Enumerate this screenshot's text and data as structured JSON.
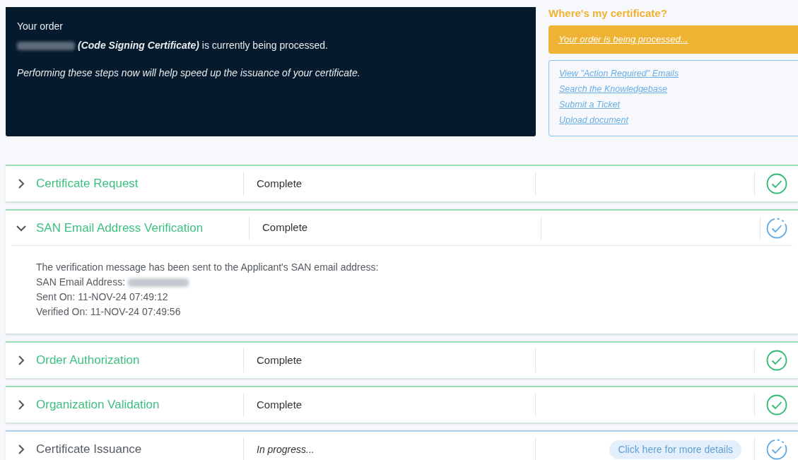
{
  "order_panel": {
    "heading": "Your order",
    "product": "(Code Signing Certificate)",
    "message": "is currently being processed.",
    "note": "Performing these steps now will help speed up the issuance of your certificate."
  },
  "help_panel": {
    "title": "Where's my certificate?",
    "status_link": "Your order is being processed...",
    "links": [
      "View \"Action Required\" Emails",
      "Search the Knowledgebase",
      "Submit a Ticket",
      "Upload document"
    ]
  },
  "steps": [
    {
      "title": "Certificate Request",
      "done": true,
      "expanded": false,
      "status": "Complete",
      "status_italic": false,
      "verified": true
    },
    {
      "title": "SAN Email Address Verification",
      "done": true,
      "expanded": true,
      "status": "Complete",
      "status_italic": false,
      "verified": false,
      "details": [
        {
          "text": "The verification message has been sent to the Applicant's SAN email address:"
        },
        {
          "text": "SAN Email Address:",
          "redacted": true
        },
        {
          "text": "Sent On: 11-NOV-24 07:49:12"
        },
        {
          "text": "Verified On: 11-NOV-24 07:49:56"
        }
      ]
    },
    {
      "title": "Order Authorization",
      "done": true,
      "expanded": false,
      "status": "Complete",
      "status_italic": false,
      "verified": true
    },
    {
      "title": "Organization Validation",
      "done": true,
      "expanded": false,
      "status": "Complete",
      "status_italic": false,
      "verified": true
    },
    {
      "title": "Certificate Issuance",
      "done": false,
      "expanded": false,
      "status": "In progress...",
      "status_italic": true,
      "verified": false,
      "action": "Click here for more details"
    }
  ]
}
